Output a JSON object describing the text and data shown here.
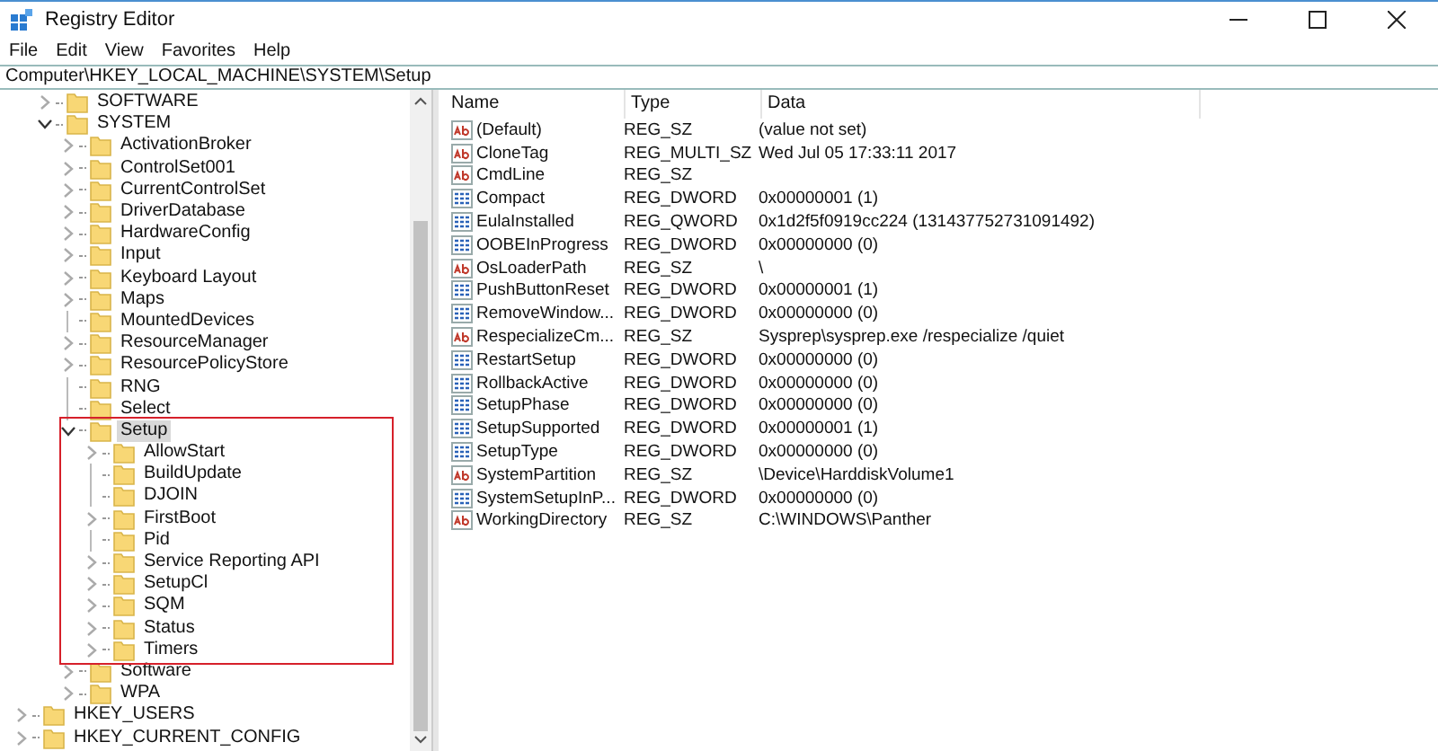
{
  "window": {
    "title": "Registry Editor"
  },
  "menu": [
    "File",
    "Edit",
    "View",
    "Favorites",
    "Help"
  ],
  "address": "Computer\\HKEY_LOCAL_MACHINE\\SYSTEM\\Setup",
  "tree": {
    "cut_off_parent_children": [
      {
        "label": "SOFTWARE",
        "expanded": false,
        "selected": false
      },
      {
        "label": "SYSTEM",
        "expanded": true,
        "selected": false,
        "children": [
          {
            "label": "ActivationBroker",
            "expanded": false,
            "selected": false
          },
          {
            "label": "ControlSet001",
            "expanded": false,
            "selected": false
          },
          {
            "label": "CurrentControlSet",
            "expanded": false,
            "selected": false
          },
          {
            "label": "DriverDatabase",
            "expanded": false,
            "selected": false
          },
          {
            "label": "HardwareConfig",
            "expanded": false,
            "selected": false
          },
          {
            "label": "Input",
            "expanded": false,
            "selected": false
          },
          {
            "label": "Keyboard Layout",
            "expanded": false,
            "selected": false
          },
          {
            "label": "Maps",
            "expanded": false,
            "selected": false
          },
          {
            "label": "MountedDevices",
            "selected": false
          },
          {
            "label": "ResourceManager",
            "expanded": false,
            "selected": false
          },
          {
            "label": "ResourcePolicyStore",
            "expanded": false,
            "selected": false
          },
          {
            "label": "RNG",
            "selected": false
          },
          {
            "label": "Select",
            "selected": false
          },
          {
            "label": "Setup",
            "expanded": true,
            "selected": true,
            "children": [
              {
                "label": "AllowStart",
                "expanded": false,
                "selected": false
              },
              {
                "label": "BuildUpdate",
                "selected": false
              },
              {
                "label": "DJOIN",
                "selected": false
              },
              {
                "label": "FirstBoot",
                "expanded": false,
                "selected": false
              },
              {
                "label": "Pid",
                "selected": false
              },
              {
                "label": "Service Reporting API",
                "expanded": false,
                "selected": false
              },
              {
                "label": "SetupCl",
                "expanded": false,
                "selected": false
              },
              {
                "label": "SQM",
                "expanded": false,
                "selected": false
              },
              {
                "label": "Status",
                "expanded": false,
                "selected": false
              },
              {
                "label": "Timers",
                "expanded": false,
                "selected": false
              }
            ]
          },
          {
            "label": "Software",
            "expanded": false,
            "selected": false
          },
          {
            "label": "WPA",
            "expanded": false,
            "selected": false
          }
        ]
      }
    ],
    "roots": [
      {
        "label": "HKEY_USERS",
        "expanded": false,
        "selected": false
      },
      {
        "label": "HKEY_CURRENT_CONFIG",
        "expanded": false,
        "selected": false
      }
    ]
  },
  "table": {
    "columns": [
      "Name",
      "Type",
      "Data"
    ],
    "rows": [
      {
        "kind": "string",
        "name": "(Default)",
        "type": "REG_SZ",
        "data": "(value not set)"
      },
      {
        "kind": "string",
        "name": "CloneTag",
        "type": "REG_MULTI_SZ",
        "data": "Wed Jul 05 17:33:11 2017"
      },
      {
        "kind": "string",
        "name": "CmdLine",
        "type": "REG_SZ"
      },
      {
        "kind": "binary",
        "name": "Compact",
        "type": "REG_DWORD",
        "data": "0x00000001 (1)"
      },
      {
        "kind": "binary",
        "name": "EulaInstalled",
        "type": "REG_QWORD",
        "data": "0x1d2f5f0919cc224 (131437752731091492)"
      },
      {
        "kind": "binary",
        "name": "OOBEInProgress",
        "type": "REG_DWORD",
        "data": "0x00000000 (0)"
      },
      {
        "kind": "string",
        "name": "OsLoaderPath",
        "type": "REG_SZ",
        "data": "\\"
      },
      {
        "kind": "binary",
        "name": "PushButtonReset",
        "type": "REG_DWORD",
        "data": "0x00000001 (1)"
      },
      {
        "kind": "binary",
        "name": "RemoveWindow...",
        "type": "REG_DWORD",
        "data": "0x00000000 (0)"
      },
      {
        "kind": "string",
        "name": "RespecializeCm...",
        "type": "REG_SZ",
        "data": "Sysprep\\sysprep.exe /respecialize /quiet"
      },
      {
        "kind": "binary",
        "name": "RestartSetup",
        "type": "REG_DWORD",
        "data": "0x00000000 (0)"
      },
      {
        "kind": "binary",
        "name": "RollbackActive",
        "type": "REG_DWORD",
        "data": "0x00000000 (0)"
      },
      {
        "kind": "binary",
        "name": "SetupPhase",
        "type": "REG_DWORD",
        "data": "0x00000000 (0)"
      },
      {
        "kind": "binary",
        "name": "SetupSupported",
        "type": "REG_DWORD",
        "data": "0x00000001 (1)"
      },
      {
        "kind": "binary",
        "name": "SetupType",
        "type": "REG_DWORD",
        "data": "0x00000000 (0)"
      },
      {
        "kind": "string",
        "name": "SystemPartition",
        "type": "REG_SZ",
        "data": "\\Device\\HarddiskVolume1"
      },
      {
        "kind": "binary",
        "name": "SystemSetupInP...",
        "type": "REG_DWORD",
        "data": "0x00000000 (0)"
      },
      {
        "kind": "string",
        "name": "WorkingDirectory",
        "type": "REG_SZ",
        "data": "C:\\WINDOWS\\Panther"
      }
    ]
  }
}
